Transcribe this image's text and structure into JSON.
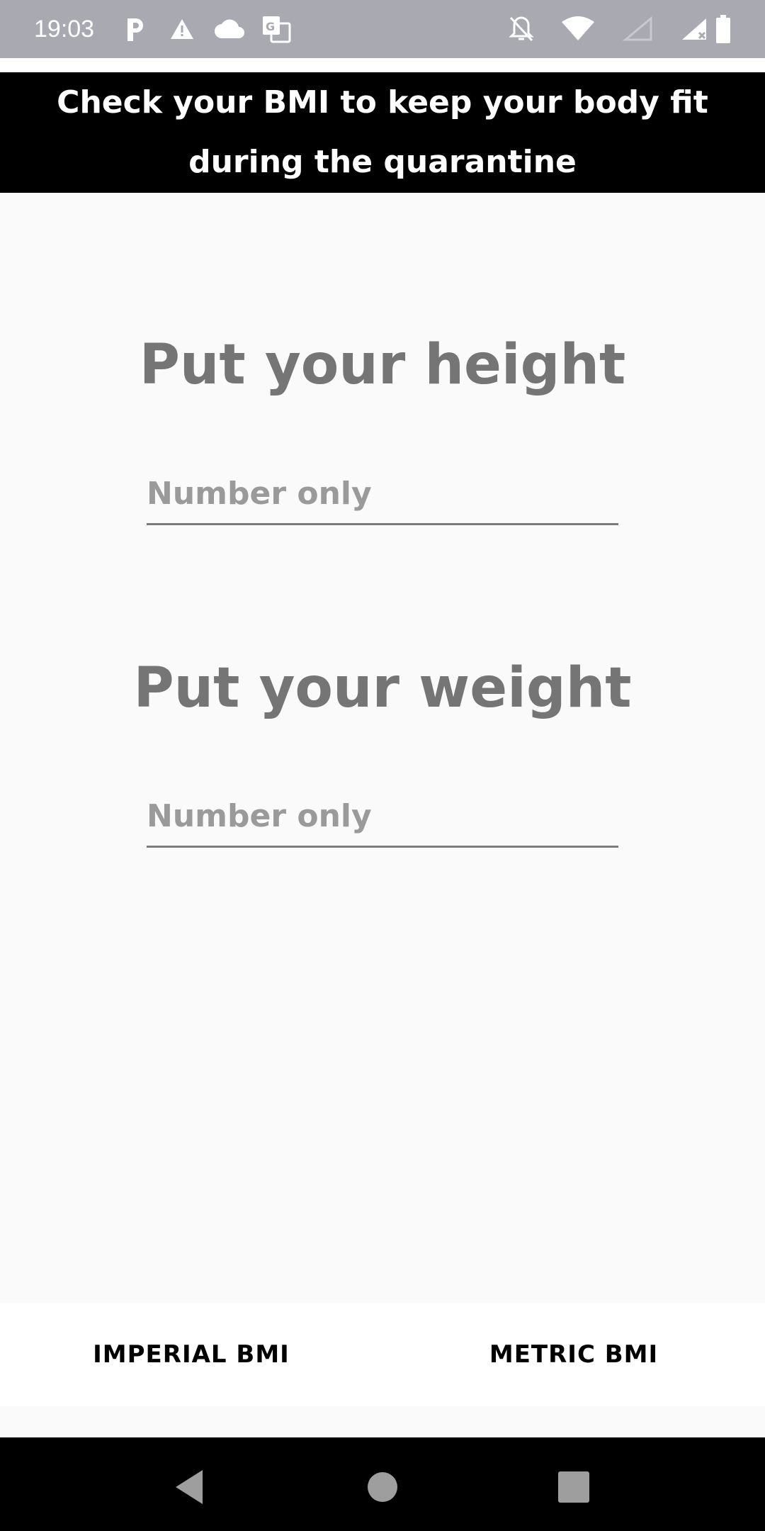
{
  "status_bar": {
    "time": "19:03",
    "left_icons": [
      "parking-icon",
      "warning-icon",
      "cloud-icon",
      "translate-icon"
    ],
    "right_icons": [
      "notifications-off-icon",
      "wifi-icon",
      "signal-empty-icon",
      "signal-icon",
      "battery-icon"
    ]
  },
  "banner": {
    "text": "Check your BMI to keep your body fit during the quarantine"
  },
  "height_section": {
    "title": "Put your height",
    "placeholder": "Number only",
    "value": ""
  },
  "weight_section": {
    "title": "Put your weight",
    "placeholder": "Number only",
    "value": ""
  },
  "tabs": {
    "imperial": "IMPERIAL BMI",
    "metric": "METRIC BMI"
  },
  "nav": {
    "icons": [
      "back-icon",
      "home-icon",
      "recents-icon"
    ]
  },
  "colors": {
    "status_bar": "#a9a9b1",
    "banner_bg": "#000000",
    "title_gray": "#757575",
    "background": "#fafafa"
  }
}
